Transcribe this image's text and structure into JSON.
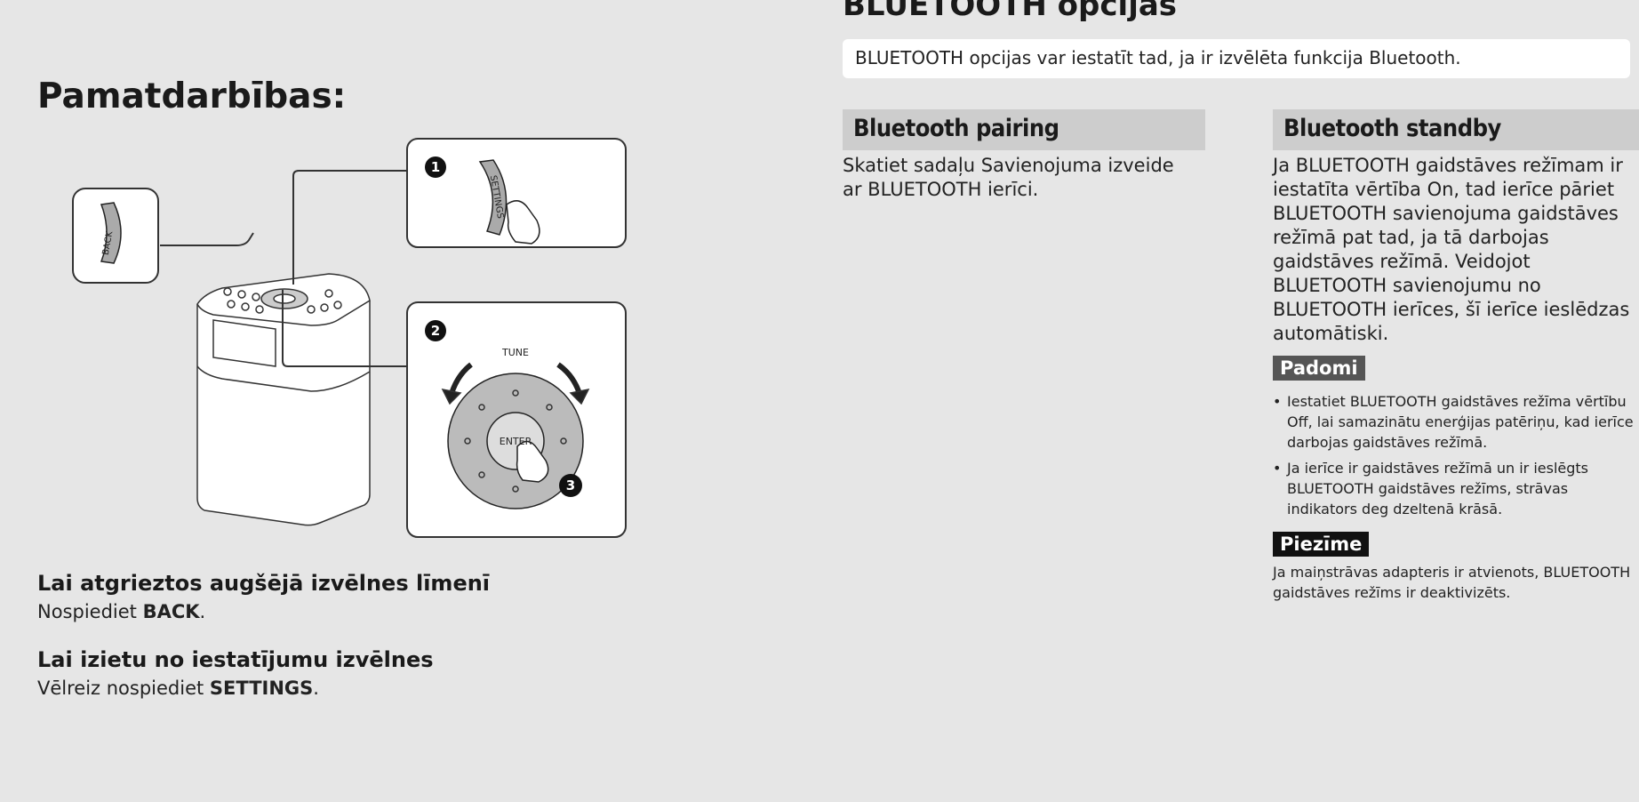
{
  "left": {
    "title": "Pamatdarbības:",
    "figure": {
      "back_label": "BACK",
      "settings_label": "SETTINGS",
      "tune_label": "TUNE",
      "enter_label": "ENTER",
      "step1": "1",
      "step2": "2",
      "step3": "3"
    },
    "section1": {
      "heading": "Lai atgrieztos augšējā izvēlnes līmenī",
      "text_before": "Nospiediet ",
      "bold": "BACK",
      "text_after": "."
    },
    "section2": {
      "heading": "Lai izietu no iestatījumu izvēlnes",
      "text_before": "Vēlreiz nospiediet ",
      "bold": "SETTINGS",
      "text_after": "."
    }
  },
  "right": {
    "title": "BLUETOOTH opcijas",
    "intro": "BLUETOOTH opcijas var iestatīt tad, ja ir izvēlēta funkcija Bluetooth.",
    "pairing": {
      "heading": "Bluetooth pairing",
      "text": "Skatiet sadaļu Savienojuma izveide ar BLUETOOTH ierīci."
    },
    "standby": {
      "heading": "Bluetooth standby",
      "text": "Ja BLUETOOTH gaidstāves režīmam ir iestatīta vērtība On, tad ierīce pāriet BLUETOOTH savienojuma gaidstāves režīmā pat tad, ja tā darbojas gaidstāves režīmā. Veidojot BLUETOOTH savienojumu no BLUETOOTH ierīces, šī ierīce ieslēdzas automātiski.",
      "tips_label": "Padomi",
      "tips": [
        "Iestatiet BLUETOOTH gaidstāves režīma vērtību Off, lai samazinātu enerģijas patēriņu, kad ierīce darbojas gaidstāves režīmā.",
        "Ja ierīce ir gaidstāves režīmā un ir ieslēgts BLUETOOTH gaidstāves režīms, strāvas indikators deg dzeltenā krāsā."
      ],
      "note_label": "Piezīme",
      "note": "Ja maiņstrāvas adapteris ir atvienots, BLUETOOTH gaidstāves režīms ir deaktivizēts."
    }
  }
}
